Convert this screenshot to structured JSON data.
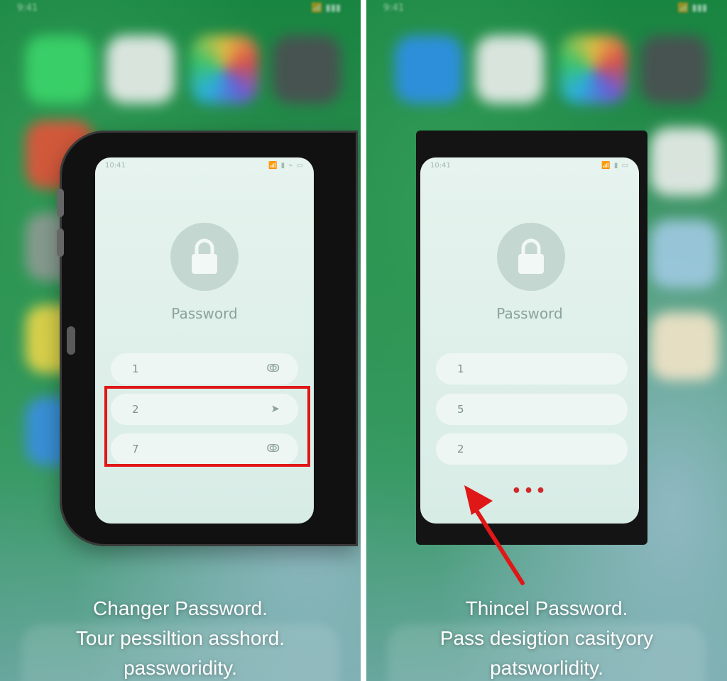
{
  "left": {
    "status": {
      "time": "9:41",
      "right": "📶 ▮▮▮"
    },
    "screen": {
      "time": "10:41",
      "status_icons": "📶 ▮ ⌁ ▭",
      "title": "Password",
      "fields": [
        {
          "value": "1",
          "icon": "eye-slash-icon"
        },
        {
          "value": "2",
          "icon": "arrow-icon"
        },
        {
          "value": "7",
          "icon": "eye-slash-icon"
        }
      ]
    },
    "caption": [
      "Changer Password.",
      "Tour pessiltion asshord.",
      "passworidity."
    ],
    "highlight_color": "#e01717"
  },
  "right": {
    "status": {
      "time": "9:41",
      "right": "📶 ▮▮▮"
    },
    "screen": {
      "time": "10:41",
      "status_icons": "📶 ▮ ▭",
      "title": "Password",
      "fields": [
        {
          "value": "1"
        },
        {
          "value": "5"
        },
        {
          "value": "2"
        }
      ],
      "dots": "•••"
    },
    "caption": [
      "Thincel Password.",
      "Pass desigtion casityory",
      "patsworlidity."
    ],
    "arrow_color": "#e01717"
  },
  "colors": {
    "screen_bg": "#e6f3ee",
    "accent_red": "#e01717",
    "background_green": "#16843f"
  }
}
